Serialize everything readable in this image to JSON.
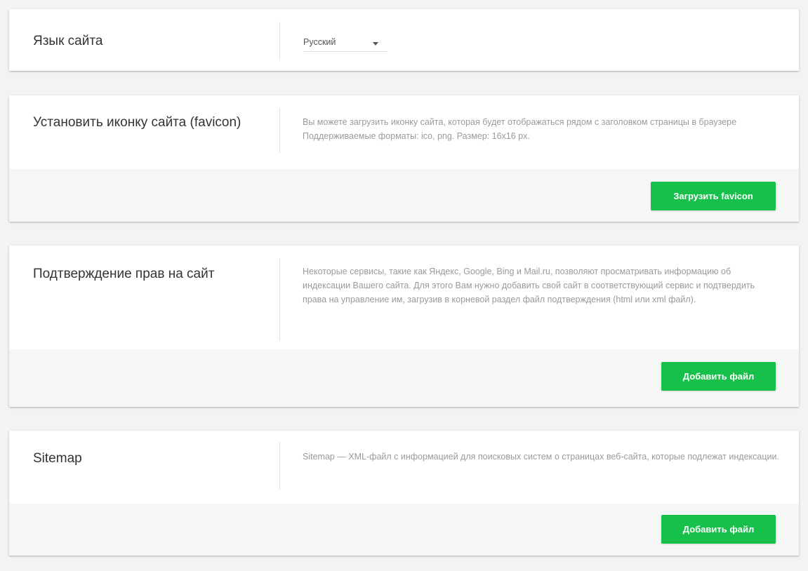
{
  "language_card": {
    "title": "Язык сайта",
    "select_value": "Русский"
  },
  "favicon_card": {
    "title": "Установить иконку сайта (favicon)",
    "description": "Вы можете загрузить иконку сайта, которая будет отображаться рядом с заголовком страницы в браузере Поддерживаемые форматы: ico, png. Размер: 16x16 px.",
    "button_label": "Загрузить favicon"
  },
  "verification_card": {
    "title": "Подтверждение прав на сайт",
    "description": "Некоторые сервисы, такие как Яндекс, Google, Bing и Mail.ru, позволяют просматривать информацию об индексации Вашего сайта. Для этого Вам нужно добавить свой сайт в соответствующий сервис и подтвердить права на управление им, загрузив в корневой раздел файл подтверждения (html или xml файл).",
    "button_label": "Добавить файл"
  },
  "sitemap_card": {
    "title": "Sitemap",
    "description": "Sitemap — XML-файл с информацией для поисковых систем о страницах веб-сайта, которые подлежат индексации.",
    "button_label": "Добавить файл"
  },
  "colors": {
    "accent_green": "#16c04a",
    "page_background": "#f3f3f3",
    "footer_background": "#f6f6f6"
  }
}
